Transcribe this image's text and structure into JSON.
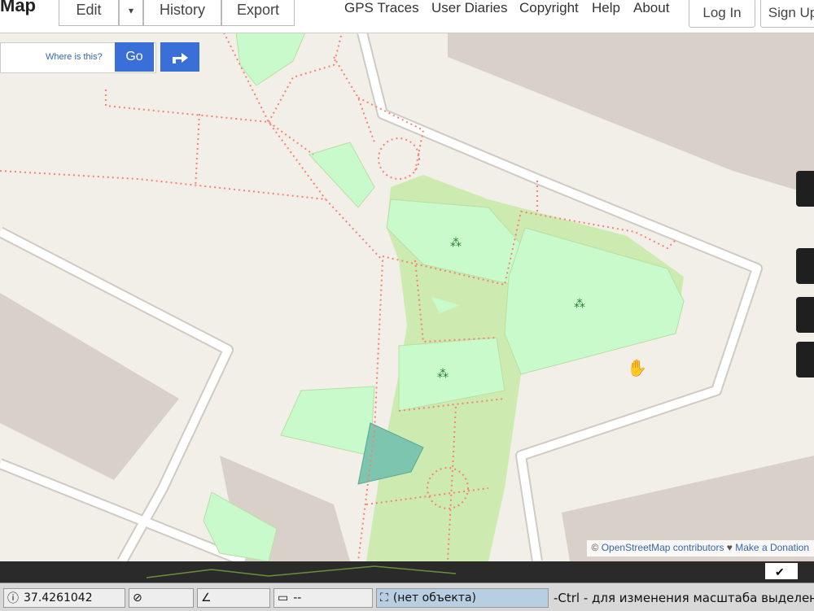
{
  "header": {
    "logo": "Map",
    "edit_label": "Edit",
    "history_label": "History",
    "export_label": "Export",
    "nav": [
      "GPS Traces",
      "User Diaries",
      "Copyright",
      "Help",
      "About"
    ],
    "login_label": "Log In",
    "signup_label": "Sign Up"
  },
  "search": {
    "placeholder": "Where is this?",
    "go_label": "Go"
  },
  "map": {
    "attribution_prefix": "© ",
    "attribution_link": "OpenStreetMap contributors",
    "attribution_suffix": " ♥ ",
    "donate_link": "Make a Donation"
  },
  "status": {
    "coordinate": "37.4261042",
    "distance": "--",
    "selection": "(нет объекта)",
    "hint": "-Ctrl - для изменения масштаба выделенн"
  },
  "colors": {
    "background": "#f2efe9",
    "park": "#cdebb0",
    "grass": "#c8facc",
    "building": "#d9d0c9",
    "path": "#fa8072",
    "accent": "#3a6fd8"
  }
}
